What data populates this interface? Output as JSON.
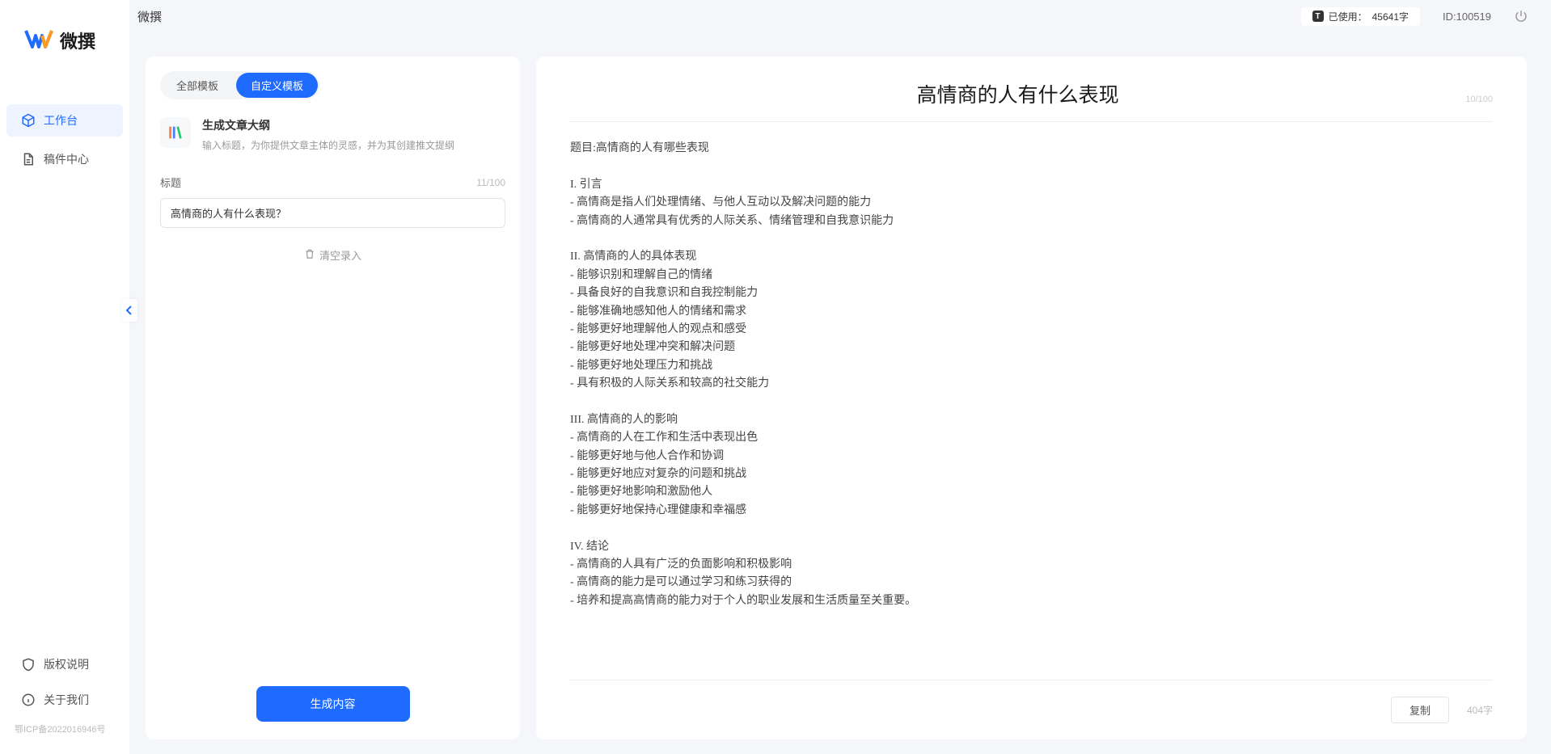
{
  "brand": {
    "name": "微撰"
  },
  "topbar": {
    "title": "微撰",
    "usage_label": "已使用：",
    "usage_value": "45641字",
    "user_id_label": "ID:100519"
  },
  "sidebar": {
    "nav": [
      {
        "label": "工作台",
        "icon": "cube-icon",
        "active": true
      },
      {
        "label": "稿件中心",
        "icon": "doc-icon",
        "active": false
      }
    ],
    "footer": [
      {
        "label": "版权说明",
        "icon": "shield-icon"
      },
      {
        "label": "关于我们",
        "icon": "info-icon"
      }
    ],
    "icp": "鄂ICP备2022016946号"
  },
  "left_panel": {
    "tabs": [
      {
        "label": "全部模板",
        "active": false
      },
      {
        "label": "自定义模板",
        "active": true
      }
    ],
    "template": {
      "title": "生成文章大纲",
      "desc": "输入标题，为你提供文章主体的灵感，并为其创建推文提纲"
    },
    "field": {
      "label": "标题",
      "count": "11/100",
      "value": "高情商的人有什么表现？"
    },
    "clear_label": "清空录入",
    "generate_label": "生成内容"
  },
  "right_panel": {
    "title": "高情商的人有什么表现",
    "title_count": "10/100",
    "body": "题目:高情商的人有哪些表现\n\nI. 引言\n- 高情商是指人们处理情绪、与他人互动以及解决问题的能力\n- 高情商的人通常具有优秀的人际关系、情绪管理和自我意识能力\n\nII. 高情商的人的具体表现\n- 能够识别和理解自己的情绪\n- 具备良好的自我意识和自我控制能力\n- 能够准确地感知他人的情绪和需求\n- 能够更好地理解他人的观点和感受\n- 能够更好地处理冲突和解决问题\n- 能够更好地处理压力和挑战\n- 具有积极的人际关系和较高的社交能力\n\nIII. 高情商的人的影响\n- 高情商的人在工作和生活中表现出色\n- 能够更好地与他人合作和协调\n- 能够更好地应对复杂的问题和挑战\n- 能够更好地影响和激励他人\n- 能够更好地保持心理健康和幸福感\n\nIV. 结论\n- 高情商的人具有广泛的负面影响和积极影响\n- 高情商的能力是可以通过学习和练习获得的\n- 培养和提高高情商的能力对于个人的职业发展和生活质量至关重要。",
    "copy_label": "复制",
    "word_count": "404字"
  }
}
